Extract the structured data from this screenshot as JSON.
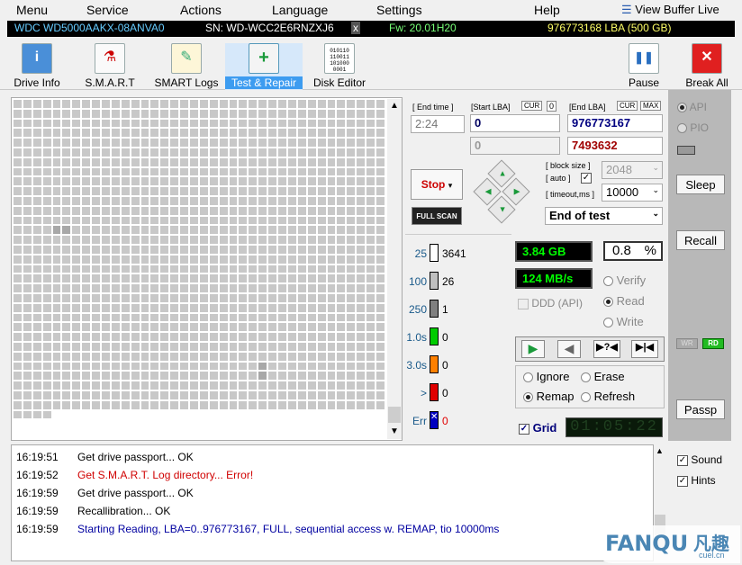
{
  "menu": {
    "items": [
      "Menu",
      "Service",
      "Actions",
      "Language",
      "Settings",
      "Help"
    ],
    "view_buffer": "View Buffer Live"
  },
  "drive": {
    "model": "WDC WD5000AAKX-08ANVA0",
    "serial": "SN: WD-WCC2E6RNZXJ6",
    "close": "x",
    "firmware": "Fw: 20.01H20",
    "capacity": "976773168 LBA (500 GB)"
  },
  "toolbar": {
    "drive_info": "Drive Info",
    "smart": "S.M.A.R.T",
    "smart_logs": "SMART Logs",
    "test_repair": "Test & Repair",
    "disk_editor": "Disk Editor",
    "pause": "Pause",
    "break_all": "Break All",
    "disk_editor_icon_text": "010110\n110011\n101000\n0001"
  },
  "test": {
    "end_time_label": "[ End time ]",
    "end_time": "2:24",
    "start_lba_label": "[Start LBA]",
    "cur1": "CUR",
    "cur1_val": "0",
    "start_lba": "0",
    "start_lba2": "0",
    "end_lba_label": "[End LBA]",
    "cur2": "CUR",
    "max": "MAX",
    "end_lba": "976773167",
    "end_lba2": "7493632",
    "stop": "Stop",
    "full_scan": "FULL SCAN",
    "block_size_label": "[ block size ]",
    "auto_label": "[ auto ]",
    "block_size": "2048",
    "timeout_label": "[ timeout,ms ]",
    "timeout": "10000",
    "end_of_test": "End of test"
  },
  "legend": [
    {
      "label": "25",
      "count": "3641",
      "color": "#ffffff"
    },
    {
      "label": "100",
      "count": "26",
      "color": "#c0c0c0"
    },
    {
      "label": "250",
      "count": "1",
      "color": "#808080"
    },
    {
      "label": "1.0s",
      "count": "0",
      "color": "#00cc00"
    },
    {
      "label": "3.0s",
      "count": "0",
      "color": "#ff8000"
    },
    {
      "label": ">",
      "count": "0",
      "color": "#e00000"
    },
    {
      "label": "Err",
      "count": "0",
      "color": "#0000c0"
    }
  ],
  "stats": {
    "gb": "3.84 GB",
    "percent": "0.8",
    "percent_sign": "%",
    "speed": "124 MB/s",
    "ddd": "DDD (API)",
    "verify": "Verify",
    "read": "Read",
    "write": "Write"
  },
  "mode": {
    "ignore": "Ignore",
    "erase": "Erase",
    "remap": "Remap",
    "refresh": "Refresh",
    "grid": "Grid",
    "timer": "01:05:22"
  },
  "side": {
    "api": "API",
    "pio": "PIO",
    "sleep": "Sleep",
    "recall": "Recall",
    "wr": "WR",
    "rd": "RD",
    "passp": "Passp"
  },
  "log": [
    {
      "time": "16:19:51",
      "msg": "Get drive passport... OK",
      "color": "#000000"
    },
    {
      "time": "16:19:52",
      "msg": "Get S.M.A.R.T. Log directory... Error!",
      "color": "#d00000"
    },
    {
      "time": "16:19:59",
      "msg": "Get drive passport... OK",
      "color": "#000000"
    },
    {
      "time": "16:19:59",
      "msg": "Recallibration... OK",
      "color": "#000000"
    },
    {
      "time": "16:19:59",
      "msg": "Starting Reading, LBA=0..976773167, FULL, sequential access w. REMAP, tio 10000ms",
      "color": "#0000a0"
    }
  ],
  "logopts": {
    "sound": "Sound",
    "hints": "Hints"
  },
  "watermark": {
    "text": "FANQU",
    "cn": "凡趣",
    "sub": "cuel.cn"
  }
}
